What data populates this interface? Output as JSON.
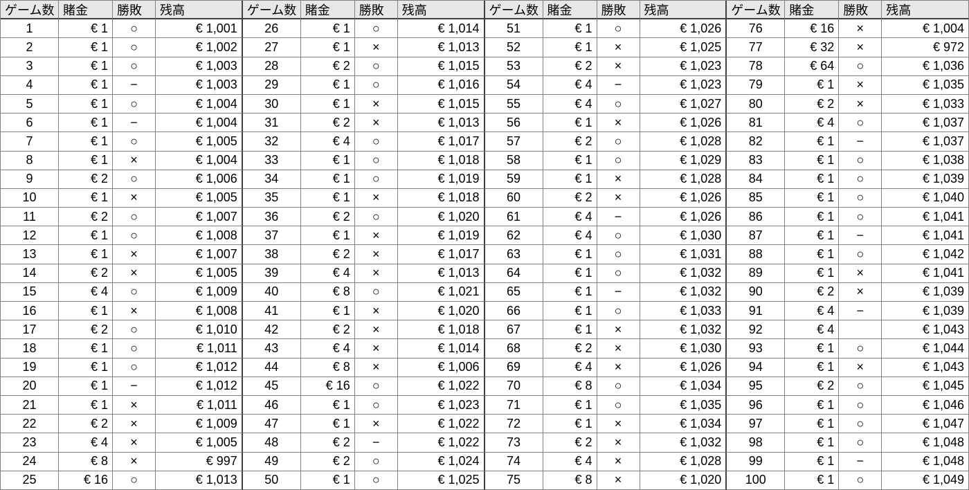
{
  "headers": {
    "game": "ゲーム数",
    "bet": "賭金",
    "result": "勝敗",
    "balance": "残高"
  },
  "chart_data": {
    "type": "table",
    "title": "",
    "columns": [
      "ゲーム数",
      "賭金",
      "勝敗",
      "残高"
    ],
    "rows": [
      {
        "game": 1,
        "bet": "€ 1",
        "result": "○",
        "balance": "€ 1,001"
      },
      {
        "game": 2,
        "bet": "€ 1",
        "result": "○",
        "balance": "€ 1,002"
      },
      {
        "game": 3,
        "bet": "€ 1",
        "result": "○",
        "balance": "€ 1,003"
      },
      {
        "game": 4,
        "bet": "€ 1",
        "result": "−",
        "balance": "€ 1,003"
      },
      {
        "game": 5,
        "bet": "€ 1",
        "result": "○",
        "balance": "€ 1,004"
      },
      {
        "game": 6,
        "bet": "€ 1",
        "result": "−",
        "balance": "€ 1,004"
      },
      {
        "game": 7,
        "bet": "€ 1",
        "result": "○",
        "balance": "€ 1,005"
      },
      {
        "game": 8,
        "bet": "€ 1",
        "result": "×",
        "balance": "€ 1,004"
      },
      {
        "game": 9,
        "bet": "€ 2",
        "result": "○",
        "balance": "€ 1,006"
      },
      {
        "game": 10,
        "bet": "€ 1",
        "result": "×",
        "balance": "€ 1,005"
      },
      {
        "game": 11,
        "bet": "€ 2",
        "result": "○",
        "balance": "€ 1,007"
      },
      {
        "game": 12,
        "bet": "€ 1",
        "result": "○",
        "balance": "€ 1,008"
      },
      {
        "game": 13,
        "bet": "€ 1",
        "result": "×",
        "balance": "€ 1,007"
      },
      {
        "game": 14,
        "bet": "€ 2",
        "result": "×",
        "balance": "€ 1,005"
      },
      {
        "game": 15,
        "bet": "€ 4",
        "result": "○",
        "balance": "€ 1,009"
      },
      {
        "game": 16,
        "bet": "€ 1",
        "result": "×",
        "balance": "€ 1,008"
      },
      {
        "game": 17,
        "bet": "€ 2",
        "result": "○",
        "balance": "€ 1,010"
      },
      {
        "game": 18,
        "bet": "€ 1",
        "result": "○",
        "balance": "€ 1,011"
      },
      {
        "game": 19,
        "bet": "€ 1",
        "result": "○",
        "balance": "€ 1,012"
      },
      {
        "game": 20,
        "bet": "€ 1",
        "result": "−",
        "balance": "€ 1,012"
      },
      {
        "game": 21,
        "bet": "€ 1",
        "result": "×",
        "balance": "€ 1,011"
      },
      {
        "game": 22,
        "bet": "€ 2",
        "result": "×",
        "balance": "€ 1,009"
      },
      {
        "game": 23,
        "bet": "€ 4",
        "result": "×",
        "balance": "€ 1,005"
      },
      {
        "game": 24,
        "bet": "€ 8",
        "result": "×",
        "balance": "€ 997"
      },
      {
        "game": 25,
        "bet": "€ 16",
        "result": "○",
        "balance": "€ 1,013"
      },
      {
        "game": 26,
        "bet": "€ 1",
        "result": "○",
        "balance": "€ 1,014"
      },
      {
        "game": 27,
        "bet": "€ 1",
        "result": "×",
        "balance": "€ 1,013"
      },
      {
        "game": 28,
        "bet": "€ 2",
        "result": "○",
        "balance": "€ 1,015"
      },
      {
        "game": 29,
        "bet": "€ 1",
        "result": "○",
        "balance": "€ 1,016"
      },
      {
        "game": 30,
        "bet": "€ 1",
        "result": "×",
        "balance": "€ 1,015"
      },
      {
        "game": 31,
        "bet": "€ 2",
        "result": "×",
        "balance": "€ 1,013"
      },
      {
        "game": 32,
        "bet": "€ 4",
        "result": "○",
        "balance": "€ 1,017"
      },
      {
        "game": 33,
        "bet": "€ 1",
        "result": "○",
        "balance": "€ 1,018"
      },
      {
        "game": 34,
        "bet": "€ 1",
        "result": "○",
        "balance": "€ 1,019"
      },
      {
        "game": 35,
        "bet": "€ 1",
        "result": "×",
        "balance": "€ 1,018"
      },
      {
        "game": 36,
        "bet": "€ 2",
        "result": "○",
        "balance": "€ 1,020"
      },
      {
        "game": 37,
        "bet": "€ 1",
        "result": "×",
        "balance": "€ 1,019"
      },
      {
        "game": 38,
        "bet": "€ 2",
        "result": "×",
        "balance": "€ 1,017"
      },
      {
        "game": 39,
        "bet": "€ 4",
        "result": "×",
        "balance": "€ 1,013"
      },
      {
        "game": 40,
        "bet": "€ 8",
        "result": "○",
        "balance": "€ 1,021"
      },
      {
        "game": 41,
        "bet": "€ 1",
        "result": "×",
        "balance": "€ 1,020"
      },
      {
        "game": 42,
        "bet": "€ 2",
        "result": "×",
        "balance": "€ 1,018"
      },
      {
        "game": 43,
        "bet": "€ 4",
        "result": "×",
        "balance": "€ 1,014"
      },
      {
        "game": 44,
        "bet": "€ 8",
        "result": "×",
        "balance": "€ 1,006"
      },
      {
        "game": 45,
        "bet": "€ 16",
        "result": "○",
        "balance": "€ 1,022"
      },
      {
        "game": 46,
        "bet": "€ 1",
        "result": "○",
        "balance": "€ 1,023"
      },
      {
        "game": 47,
        "bet": "€ 1",
        "result": "×",
        "balance": "€ 1,022"
      },
      {
        "game": 48,
        "bet": "€ 2",
        "result": "−",
        "balance": "€ 1,022"
      },
      {
        "game": 49,
        "bet": "€ 2",
        "result": "○",
        "balance": "€ 1,024"
      },
      {
        "game": 50,
        "bet": "€ 1",
        "result": "○",
        "balance": "€ 1,025"
      },
      {
        "game": 51,
        "bet": "€ 1",
        "result": "○",
        "balance": "€ 1,026"
      },
      {
        "game": 52,
        "bet": "€ 1",
        "result": "×",
        "balance": "€ 1,025"
      },
      {
        "game": 53,
        "bet": "€ 2",
        "result": "×",
        "balance": "€ 1,023"
      },
      {
        "game": 54,
        "bet": "€ 4",
        "result": "−",
        "balance": "€ 1,023"
      },
      {
        "game": 55,
        "bet": "€ 4",
        "result": "○",
        "balance": "€ 1,027"
      },
      {
        "game": 56,
        "bet": "€ 1",
        "result": "×",
        "balance": "€ 1,026"
      },
      {
        "game": 57,
        "bet": "€ 2",
        "result": "○",
        "balance": "€ 1,028"
      },
      {
        "game": 58,
        "bet": "€ 1",
        "result": "○",
        "balance": "€ 1,029"
      },
      {
        "game": 59,
        "bet": "€ 1",
        "result": "×",
        "balance": "€ 1,028"
      },
      {
        "game": 60,
        "bet": "€ 2",
        "result": "×",
        "balance": "€ 1,026"
      },
      {
        "game": 61,
        "bet": "€ 4",
        "result": "−",
        "balance": "€ 1,026"
      },
      {
        "game": 62,
        "bet": "€ 4",
        "result": "○",
        "balance": "€ 1,030"
      },
      {
        "game": 63,
        "bet": "€ 1",
        "result": "○",
        "balance": "€ 1,031"
      },
      {
        "game": 64,
        "bet": "€ 1",
        "result": "○",
        "balance": "€ 1,032"
      },
      {
        "game": 65,
        "bet": "€ 1",
        "result": "−",
        "balance": "€ 1,032"
      },
      {
        "game": 66,
        "bet": "€ 1",
        "result": "○",
        "balance": "€ 1,033"
      },
      {
        "game": 67,
        "bet": "€ 1",
        "result": "×",
        "balance": "€ 1,032"
      },
      {
        "game": 68,
        "bet": "€ 2",
        "result": "×",
        "balance": "€ 1,030"
      },
      {
        "game": 69,
        "bet": "€ 4",
        "result": "×",
        "balance": "€ 1,026"
      },
      {
        "game": 70,
        "bet": "€ 8",
        "result": "○",
        "balance": "€ 1,034"
      },
      {
        "game": 71,
        "bet": "€ 1",
        "result": "○",
        "balance": "€ 1,035"
      },
      {
        "game": 72,
        "bet": "€ 1",
        "result": "×",
        "balance": "€ 1,034"
      },
      {
        "game": 73,
        "bet": "€ 2",
        "result": "×",
        "balance": "€ 1,032"
      },
      {
        "game": 74,
        "bet": "€ 4",
        "result": "×",
        "balance": "€ 1,028"
      },
      {
        "game": 75,
        "bet": "€ 8",
        "result": "×",
        "balance": "€ 1,020"
      },
      {
        "game": 76,
        "bet": "€ 16",
        "result": "×",
        "balance": "€ 1,004"
      },
      {
        "game": 77,
        "bet": "€ 32",
        "result": "×",
        "balance": "€ 972"
      },
      {
        "game": 78,
        "bet": "€ 64",
        "result": "○",
        "balance": "€ 1,036"
      },
      {
        "game": 79,
        "bet": "€ 1",
        "result": "×",
        "balance": "€ 1,035"
      },
      {
        "game": 80,
        "bet": "€ 2",
        "result": "×",
        "balance": "€ 1,033"
      },
      {
        "game": 81,
        "bet": "€ 4",
        "result": "○",
        "balance": "€ 1,037"
      },
      {
        "game": 82,
        "bet": "€ 1",
        "result": "−",
        "balance": "€ 1,037"
      },
      {
        "game": 83,
        "bet": "€ 1",
        "result": "○",
        "balance": "€ 1,038"
      },
      {
        "game": 84,
        "bet": "€ 1",
        "result": "○",
        "balance": "€ 1,039"
      },
      {
        "game": 85,
        "bet": "€ 1",
        "result": "○",
        "balance": "€ 1,040"
      },
      {
        "game": 86,
        "bet": "€ 1",
        "result": "○",
        "balance": "€ 1,041"
      },
      {
        "game": 87,
        "bet": "€ 1",
        "result": "−",
        "balance": "€ 1,041"
      },
      {
        "game": 88,
        "bet": "€ 1",
        "result": "○",
        "balance": "€ 1,042"
      },
      {
        "game": 89,
        "bet": "€ 1",
        "result": "×",
        "balance": "€ 1,041"
      },
      {
        "game": 90,
        "bet": "€ 2",
        "result": "×",
        "balance": "€ 1,039"
      },
      {
        "game": 91,
        "bet": "€ 4",
        "result": "−",
        "balance": "€ 1,039"
      },
      {
        "game": 92,
        "bet": "€ 4",
        "result": "",
        "balance": "€ 1,043"
      },
      {
        "game": 93,
        "bet": "€ 1",
        "result": "○",
        "balance": "€ 1,044"
      },
      {
        "game": 94,
        "bet": "€ 1",
        "result": "×",
        "balance": "€ 1,043"
      },
      {
        "game": 95,
        "bet": "€ 2",
        "result": "○",
        "balance": "€ 1,045"
      },
      {
        "game": 96,
        "bet": "€ 1",
        "result": "○",
        "balance": "€ 1,046"
      },
      {
        "game": 97,
        "bet": "€ 1",
        "result": "○",
        "balance": "€ 1,047"
      },
      {
        "game": 98,
        "bet": "€ 1",
        "result": "○",
        "balance": "€ 1,048"
      },
      {
        "game": 99,
        "bet": "€ 1",
        "result": "−",
        "balance": "€ 1,048"
      },
      {
        "game": 100,
        "bet": "€ 1",
        "result": "○",
        "balance": "€ 1,049"
      }
    ]
  }
}
